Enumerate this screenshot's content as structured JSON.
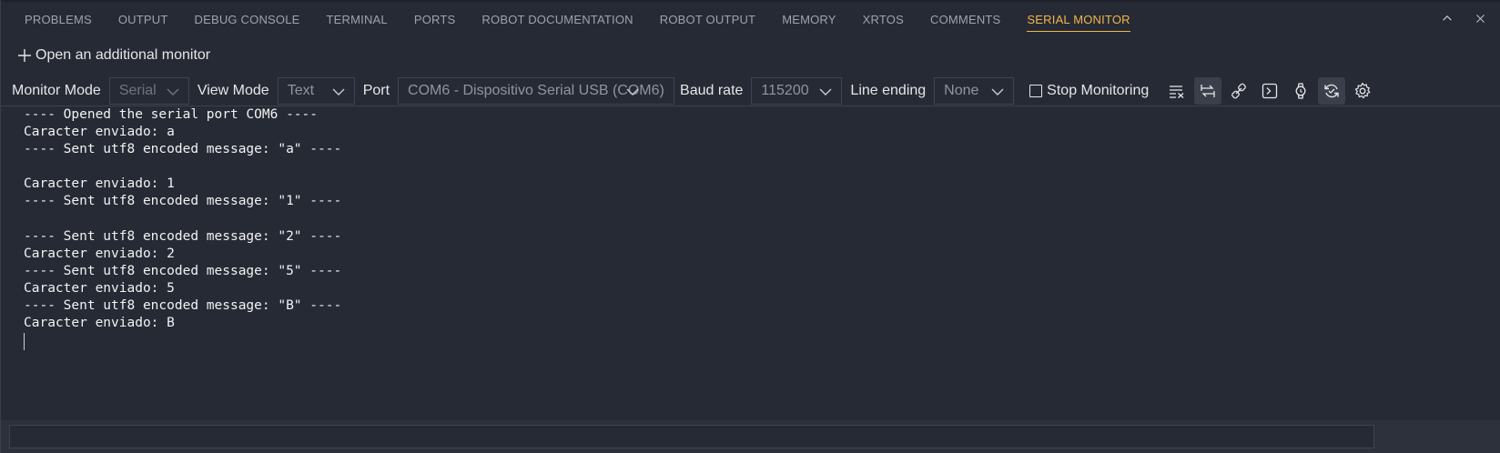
{
  "tabs": [
    {
      "label": "PROBLEMS"
    },
    {
      "label": "OUTPUT"
    },
    {
      "label": "DEBUG CONSOLE"
    },
    {
      "label": "TERMINAL"
    },
    {
      "label": "PORTS"
    },
    {
      "label": "ROBOT DOCUMENTATION"
    },
    {
      "label": "ROBOT OUTPUT"
    },
    {
      "label": "MEMORY"
    },
    {
      "label": "XRTOS"
    },
    {
      "label": "COMMENTS"
    },
    {
      "label": "SERIAL MONITOR",
      "active": true
    }
  ],
  "panel_actions": {
    "maximize_icon": "chevron-up-icon",
    "close_icon": "close-icon"
  },
  "open_monitor": {
    "label": "Open an additional monitor",
    "icon": "plus-icon"
  },
  "toolbar": {
    "monitor_mode_label": "Monitor Mode",
    "monitor_mode_value": "Serial",
    "view_mode_label": "View Mode",
    "view_mode_value": "Text",
    "port_label": "Port",
    "port_value": "COM6 - Dispositivo Serial USB (COM6)",
    "baud_label": "Baud rate",
    "baud_value": "115200",
    "line_ending_label": "Line ending",
    "line_ending_value": "None",
    "stop_monitoring_label": "Stop Monitoring",
    "stop_monitoring_checked": false,
    "icons": [
      "clear-output-icon",
      "toggle-autoscroll-icon",
      "connect-icon",
      "terminal-icon",
      "watch-icon",
      "sync-icon",
      "settings-icon"
    ]
  },
  "output_lines": [
    "---- Opened the serial port COM6 ----",
    "Caracter enviado: a",
    "---- Sent utf8 encoded message: \"a\" ----",
    "",
    "Caracter enviado: 1",
    "---- Sent utf8 encoded message: \"1\" ----",
    "",
    "---- Sent utf8 encoded message: \"2\" ----",
    "Caracter enviado: 2",
    "---- Sent utf8 encoded message: \"5\" ----",
    "Caracter enviado: 5",
    "---- Sent utf8 encoded message: \"B\" ----",
    "Caracter enviado: B"
  ],
  "colors": {
    "background": "#262a35",
    "accent": "#f0b64a",
    "text": "#cccccc",
    "output_text": "#f2f2f2"
  }
}
